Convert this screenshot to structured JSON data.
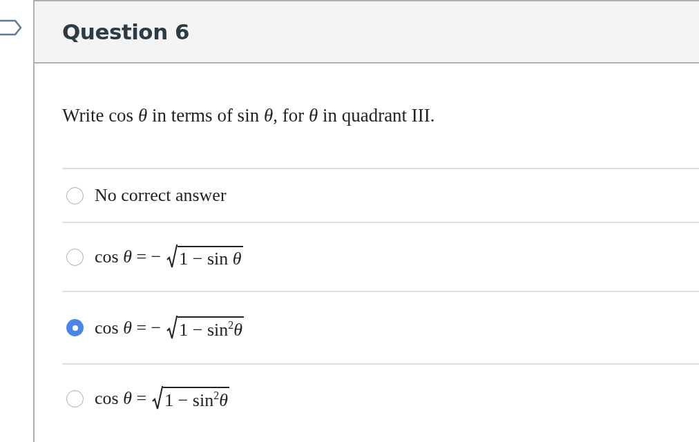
{
  "question": {
    "title": "Question 6",
    "text": "Write cos *θ* in terms of sin *θ*, for *θ* in quadrant III."
  },
  "answers": [
    {
      "kind": "text",
      "text": "No correct answer",
      "selected": false
    },
    {
      "kind": "formula",
      "lhs": "cos *θ* =",
      "sign": "−",
      "radicand": "1 − sin *θ*",
      "selected": false
    },
    {
      "kind": "formula",
      "lhs": "cos *θ* =",
      "sign": "−",
      "radicand": "1 − sin$^{2}$*θ*",
      "selected": true
    },
    {
      "kind": "formula",
      "lhs": "cos *θ* =",
      "radicand": "1 − sin$^{2}$*θ*",
      "selected": false
    }
  ]
}
